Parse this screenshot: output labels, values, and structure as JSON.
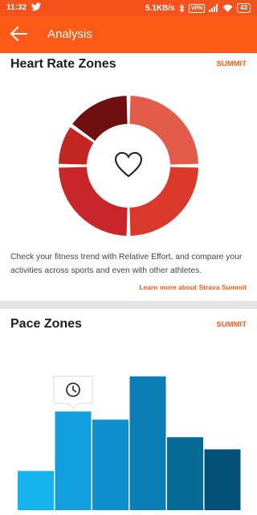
{
  "status_bar": {
    "time": "11:32",
    "net_speed": "5.1KB/s",
    "vpn": "VPN",
    "battery": "43"
  },
  "app_bar": {
    "title": "Analysis",
    "back_icon": "arrow-left-icon"
  },
  "heart_rate": {
    "title": "Heart Rate Zones",
    "summit_label": "SUMMIT",
    "center_icon": "heart-outline-icon",
    "description": "Check your fitness trend with Relative Effort, and compare your activities across sports and even with other athletes.",
    "learn_more": "Learn more about Strava Summit",
    "zone_colors": [
      "#e35c4a",
      "#d9382a",
      "#c8262a",
      "#c22724",
      "#8e1a1a",
      "#6f0f0f"
    ]
  },
  "pace": {
    "title": "Pace Zones",
    "summit_label": "SUMMIT",
    "badge_icon": "clock-icon",
    "bar_levels": [
      0.29,
      0.73,
      0.67,
      0.99,
      0.54,
      0.45
    ],
    "bar_colors": [
      "#16b3ef",
      "#129fdf",
      "#0f90cc",
      "#0b7fb5",
      "#076a96",
      "#045278"
    ]
  }
}
